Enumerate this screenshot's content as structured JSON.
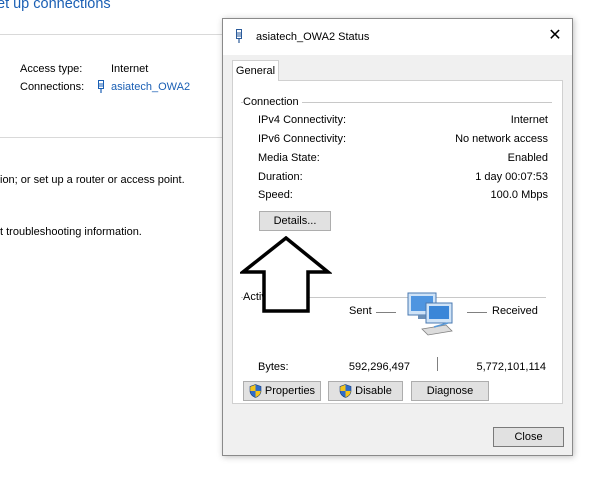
{
  "background": {
    "heading": "et up connections",
    "access_type_label": "Access type:",
    "access_type_value": "Internet",
    "connections_label": "Connections:",
    "connections_value": "asiatech_OWA2",
    "text_line1": "ion; or set up a router or access point.",
    "text_line2": "t troubleshooting information."
  },
  "dialog": {
    "title": "asiatech_OWA2 Status",
    "close_glyph": "✕",
    "tab": "General",
    "connection_group": "Connection",
    "rows": [
      {
        "label": "IPv4 Connectivity:",
        "value": "Internet"
      },
      {
        "label": "IPv6 Connectivity:",
        "value": "No network access"
      },
      {
        "label": "Media State:",
        "value": "Enabled"
      },
      {
        "label": "Duration:",
        "value": "1 day 00:07:53"
      },
      {
        "label": "Speed:",
        "value": "100.0 Mbps"
      }
    ],
    "details_button": "Details...",
    "activity_group": "Activity",
    "sent_label": "Sent",
    "received_label": "Received",
    "bytes_label": "Bytes:",
    "bytes_sent": "592,296,497",
    "bytes_received": "5,772,101,114",
    "properties_button": "Properties",
    "disable_button": "Disable",
    "diagnose_button": "Diagnose",
    "close_button": "Close"
  },
  "icons": {
    "wifi": "wifi-signal-icon",
    "network_activity": "network-computers-icon",
    "shield": "uac-shield-icon",
    "arrow": "up-arrow-annotation"
  },
  "colors": {
    "link": "#1a5fb4",
    "dialog_bg": "#f0f0f0",
    "button_bg": "#e1e1e1"
  }
}
